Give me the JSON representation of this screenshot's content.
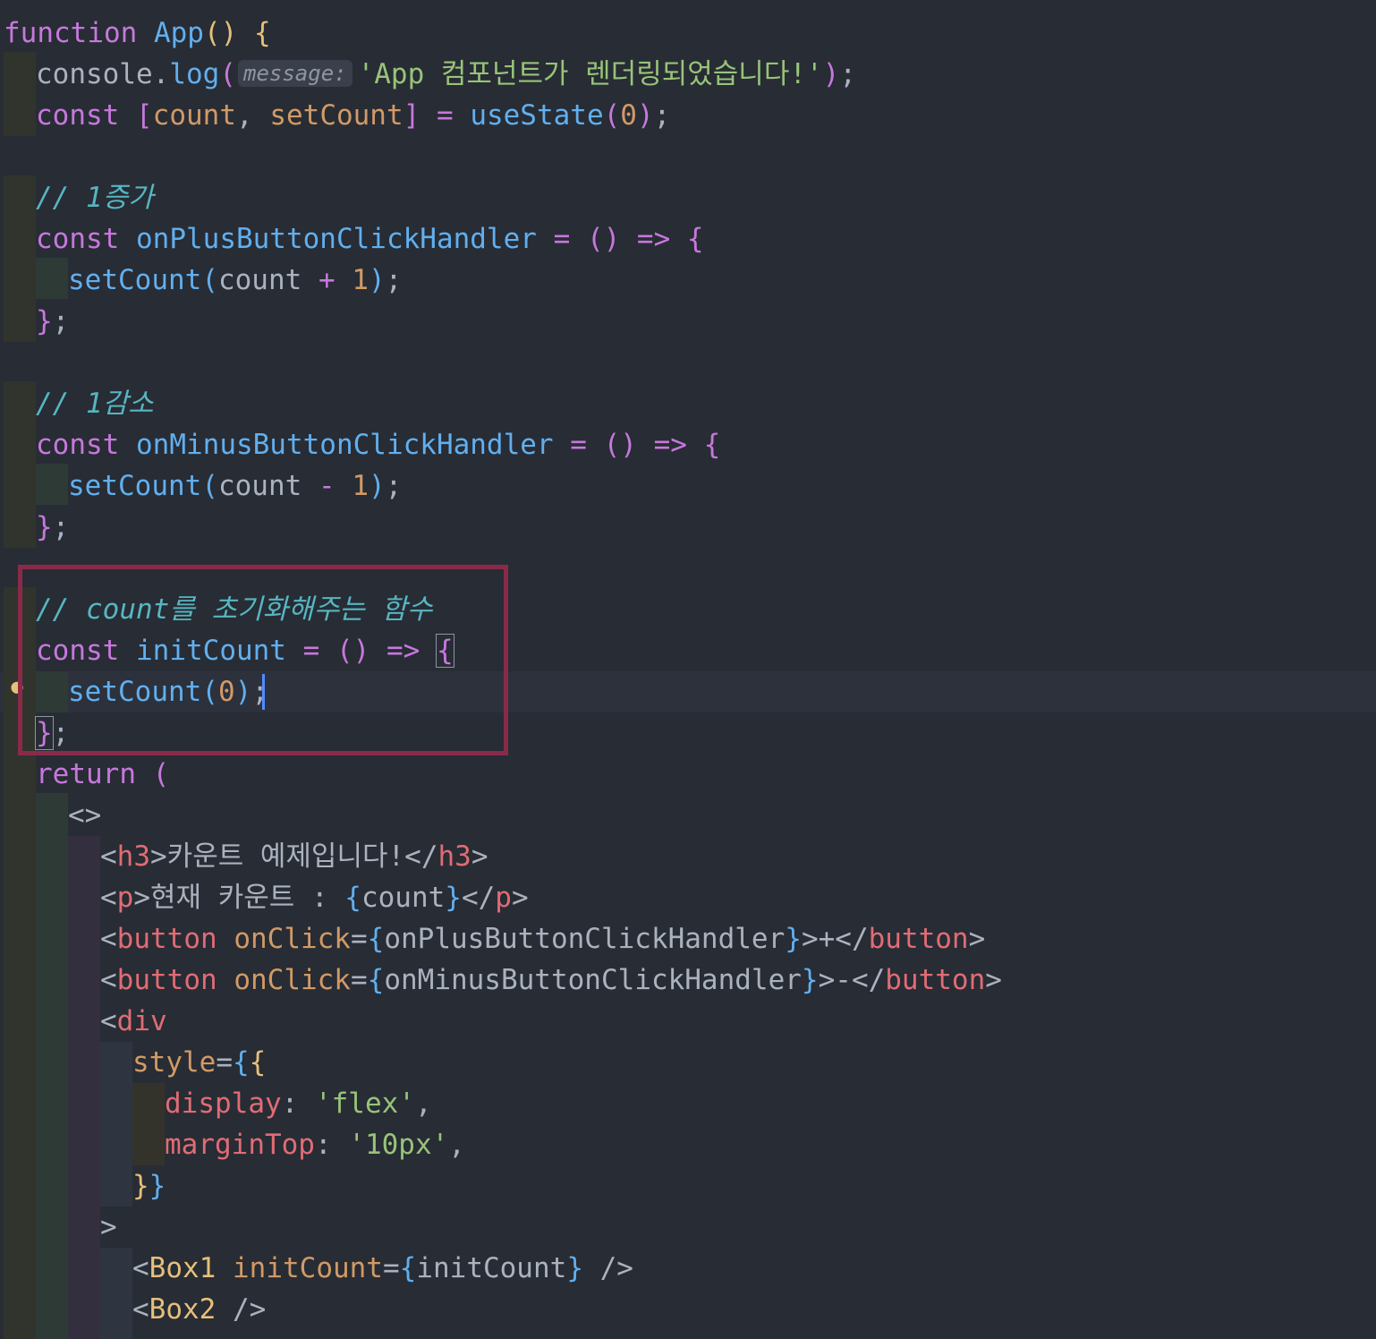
{
  "editor": {
    "hint_label": "message:",
    "lines": {
      "l01": [
        "function",
        " ",
        "App",
        "(",
        ")",
        " ",
        "{"
      ],
      "l02": [
        "console",
        ".",
        "log",
        "(",
        "'App 컴포넌트가 렌더링되었습니다!'",
        ")",
        ";"
      ],
      "l03": [
        "const",
        " ",
        "[",
        "count",
        ", ",
        "setCount",
        "]",
        " = ",
        "useState",
        "(",
        "0",
        ")",
        ";"
      ],
      "l05": [
        "// 1증가"
      ],
      "l06": [
        "const",
        " ",
        "onPlusButtonClickHandler",
        " = ",
        "()",
        " => ",
        "{"
      ],
      "l07": [
        "setCount",
        "(",
        "count",
        " + ",
        "1",
        ")",
        ";"
      ],
      "l08": [
        "}",
        ";"
      ],
      "l10": [
        "// 1감소"
      ],
      "l11": [
        "const",
        " ",
        "onMinusButtonClickHandler",
        " = ",
        "()",
        " => ",
        "{"
      ],
      "l12": [
        "setCount",
        "(",
        "count",
        " - ",
        "1",
        ")",
        ";"
      ],
      "l13": [
        "}",
        ";"
      ],
      "l15": [
        "// count를 초기화해주는 함수"
      ],
      "l16": [
        "const",
        " ",
        "initCount",
        " = ",
        "()",
        " => ",
        "{"
      ],
      "l17": [
        "setCount",
        "(",
        "0",
        ")",
        ";"
      ],
      "l18": [
        "}",
        ";"
      ],
      "l19": [
        "return",
        " ",
        "("
      ],
      "l20": [
        "<>"
      ],
      "l21": [
        "<",
        "h3",
        ">",
        "카운트 예제입니다!",
        "</",
        "h3",
        ">"
      ],
      "l22": [
        "<",
        "p",
        ">",
        "현재 카운트 : ",
        "{",
        "count",
        "}",
        "</",
        "p",
        ">"
      ],
      "l23": [
        "<",
        "button",
        " ",
        "onClick",
        "=",
        "{",
        "onPlusButtonClickHandler",
        "}",
        ">",
        "+",
        "</",
        "button",
        ">"
      ],
      "l24": [
        "<",
        "button",
        " ",
        "onClick",
        "=",
        "{",
        "onMinusButtonClickHandler",
        "}",
        ">",
        "-",
        "</",
        "button",
        ">"
      ],
      "l25": [
        "<",
        "div"
      ],
      "l26": [
        "style",
        "=",
        "{",
        "{"
      ],
      "l27": [
        "display",
        ": ",
        "'flex'",
        ","
      ],
      "l28": [
        "marginTop",
        ": ",
        "'10px'",
        ","
      ],
      "l29": [
        "}",
        "}"
      ],
      "l30": [
        ">"
      ],
      "l31": [
        "<",
        "Box1",
        " ",
        "initCount",
        "=",
        "{",
        "initCount",
        "}",
        " />"
      ],
      "l32": [
        "<",
        "Box2",
        " />"
      ]
    }
  },
  "colors": {
    "background": "#282c34",
    "keyword": "#c678dd",
    "function": "#61afef",
    "string": "#98c379",
    "number": "#d19a66",
    "variable": "#e06c75",
    "comment": "#56b6c2",
    "highlight_box": "#8a2a4a",
    "caret": "#528bff"
  }
}
